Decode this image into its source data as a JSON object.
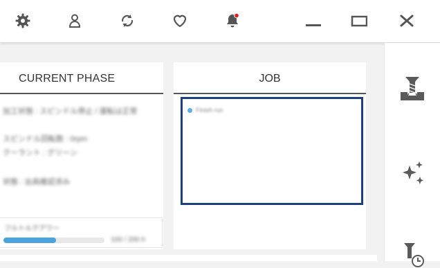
{
  "toolbar": {
    "icons": [
      "gear-icon",
      "user-icon",
      "refresh-icon",
      "heart-icon",
      "bell-icon",
      "minimize-icon",
      "maximize-icon",
      "close-icon"
    ],
    "notification_color": "#e02020"
  },
  "left_panel": {
    "title": "CURRENT PHASE",
    "lines": [
      "加工状態 : スピンドル停止 / 運転は正常",
      "スピンドル回転数 : 0rpm",
      "クーラント : グリーン",
      "状態 : 治具確認済み"
    ],
    "progress": {
      "label": "フルトルクアワー",
      "count": "100 / 200 h",
      "fraction": 0.52
    }
  },
  "job_panel": {
    "title": "JOB",
    "items": [
      "Finish run"
    ]
  },
  "colors": {
    "accent_blue": "#1c3f84",
    "progress_blue": "#4aa3df",
    "icon_gray": "#555555"
  }
}
